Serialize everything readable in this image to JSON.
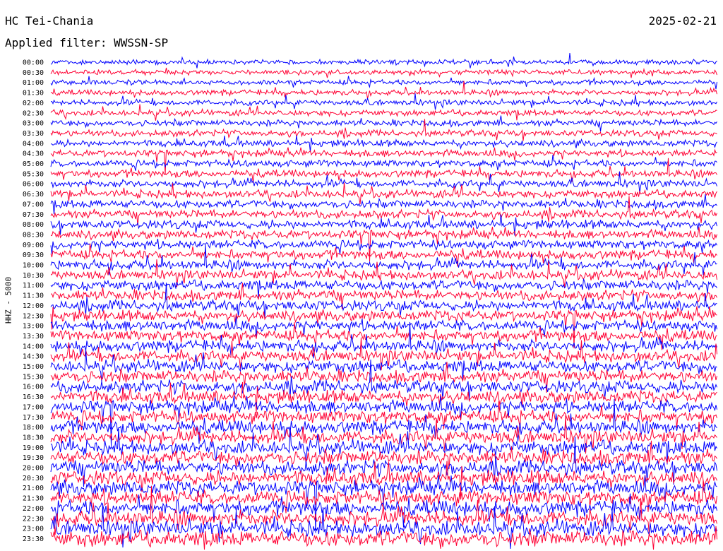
{
  "header": {
    "station": "HC Tei-Chania",
    "date": "2025-02-21",
    "filter": "Applied filter: WWSSN-SP"
  },
  "chart_data": {
    "type": "line",
    "ylabel": "HHZ - 5000",
    "row_labels": [
      "00:00",
      "00:30",
      "01:00",
      "01:30",
      "02:00",
      "02:30",
      "03:00",
      "03:30",
      "04:00",
      "04:30",
      "05:00",
      "05:30",
      "06:00",
      "06:30",
      "07:00",
      "07:30",
      "08:00",
      "08:30",
      "09:00",
      "09:30",
      "10:00",
      "10:30",
      "11:00",
      "11:30",
      "12:00",
      "12:30",
      "13:00",
      "13:30",
      "14:00",
      "14:30",
      "15:00",
      "15:30",
      "16:00",
      "16:30",
      "17:00",
      "17:30",
      "18:00",
      "18:30",
      "19:00",
      "19:30",
      "20:00",
      "20:30",
      "21:00",
      "21:30",
      "22:00",
      "22:30",
      "23:00",
      "23:30"
    ],
    "trace_colors": [
      "#0000ff",
      "#ff0033"
    ],
    "grid": false
  }
}
